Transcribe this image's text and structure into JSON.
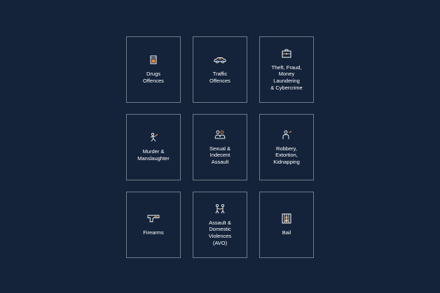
{
  "colors": {
    "background": "#14233a",
    "card_border": "#6f7c89",
    "icon_line": "#ffffff",
    "icon_accent": "#e08a3c",
    "text": "#ffffff"
  },
  "categories": [
    {
      "label": "Drugs\nOffences",
      "icon": "pill-box-icon"
    },
    {
      "label": "Traffic\nOffences",
      "icon": "car-icon"
    },
    {
      "label": "Theft, Fraud,\nMoney\nLaundering\n& Cybercrime",
      "icon": "briefcase-icon"
    },
    {
      "label": "Murder &\nManslaughter",
      "icon": "knife-icon"
    },
    {
      "label": "Sexual &\nIndecent\nAssault",
      "icon": "people-icon"
    },
    {
      "label": "Robbery,\nExtortion,\nKidnapping",
      "icon": "robber-icon"
    },
    {
      "label": "Firearms",
      "icon": "gun-icon"
    },
    {
      "label": "Assault &\nDomestic\nViolences\n(AVO)",
      "icon": "fight-icon"
    },
    {
      "label": "Bail",
      "icon": "jail-icon"
    }
  ]
}
